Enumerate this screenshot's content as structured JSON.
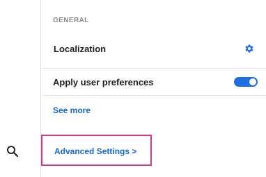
{
  "left_rail": {
    "icon": "search-icon"
  },
  "panel": {
    "section_header": "GENERAL",
    "localization": {
      "label": "Localization",
      "icon": "gear-icon"
    },
    "preferences": {
      "label": "Apply user preferences",
      "toggle_on": true
    },
    "see_more_label": "See more",
    "advanced_label": "Advanced Settings >"
  },
  "colors": {
    "accent": "#1565d8",
    "toggle": "#1f6fe0",
    "highlight_border": "#d6387e"
  }
}
